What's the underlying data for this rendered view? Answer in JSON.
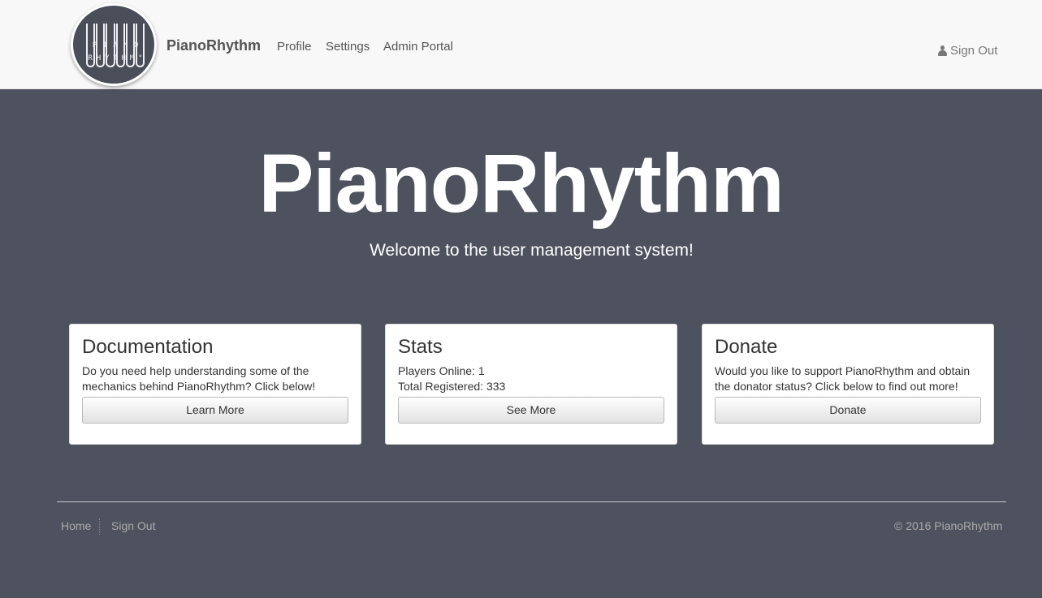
{
  "header": {
    "logo_top_letters": [
      "P",
      "I",
      "A",
      "N",
      "O"
    ],
    "logo_bottom_letters": [
      "R",
      "H",
      "Y",
      "T",
      "H",
      "M",
      "°"
    ],
    "brand": "PianoRhythm",
    "nav": {
      "profile": "Profile",
      "settings": "Settings",
      "admin": "Admin Portal"
    },
    "signout": "Sign Out"
  },
  "hero": {
    "title": "PianoRhythm",
    "subtitle": "Welcome to the user management system!"
  },
  "cards": [
    {
      "title": "Documentation",
      "text": "Do you need help understanding some of the mechanics behind PianoRhythm? Click below!",
      "button": "Learn More"
    },
    {
      "title": "Stats",
      "line1": "Players Online: 1",
      "line2": "Total Registered: 333",
      "button": "See More"
    },
    {
      "title": "Donate",
      "text": "Would you like to support PianoRhythm and obtain the donator status? Click below to find out more!",
      "button": "Donate"
    }
  ],
  "footer": {
    "home": "Home",
    "signout": "Sign Out",
    "copyright": "© 2016 PianoRhythm"
  }
}
